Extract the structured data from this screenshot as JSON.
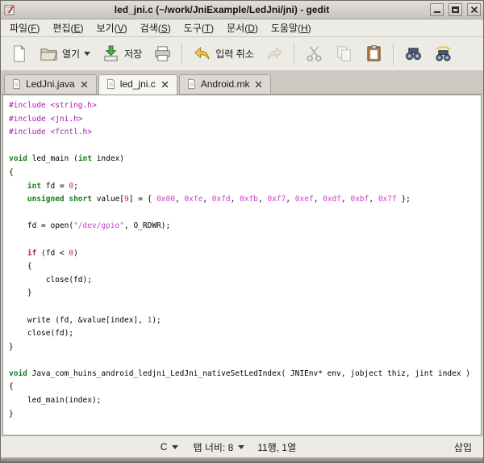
{
  "window": {
    "title": "led_jni.c (~/work/JniExample/LedJni/jni) - gedit"
  },
  "menu": {
    "items": [
      "파일(F)",
      "편집(E)",
      "보기(V)",
      "검색(S)",
      "도구(T)",
      "문서(D)",
      "도움말(H)"
    ]
  },
  "toolbar": {
    "open_label": "열기",
    "save_label": "저장",
    "undo_label": "입력 취소"
  },
  "tabs": [
    {
      "label": "LedJni.java",
      "active": false
    },
    {
      "label": "led_jni.c",
      "active": true
    },
    {
      "label": "Android.mk",
      "active": false
    }
  ],
  "statusbar": {
    "language": "C",
    "tab_width": "탭 너비: 8",
    "cursor_position": "11행, 1열",
    "mode": "삽입"
  },
  "icons": {
    "titlebar": [
      "gedit-logo-icon",
      "minimize-icon",
      "maximize-icon",
      "close-icon"
    ],
    "toolbar": [
      "new-document-icon",
      "open-folder-icon",
      "save-icon",
      "print-icon",
      "undo-icon",
      "redo-icon",
      "cut-icon",
      "copy-icon",
      "paste-icon",
      "find-icon",
      "find-replace-icon"
    ],
    "tabs": [
      "document-icon",
      "close-icon"
    ],
    "statusbar": [
      "chevron-down-icon"
    ]
  },
  "colors": {
    "chrome_bg": "#edebe6",
    "titlebar_bg": "#d4d1ca",
    "code_bg": "#ffffff",
    "preprocessor": "#b116b1",
    "type_keyword": "#18801c",
    "control_keyword": "#b22222",
    "number": "#d42a2a",
    "hex_number": "#cf3ecb",
    "string": "#cf3ecb",
    "undo_arrow": "#f6c445",
    "save_arrow": "#4caf50"
  },
  "code": {
    "lines": [
      [
        {
          "t": "#include <string.h>",
          "c": "pre"
        }
      ],
      [
        {
          "t": "#include <jni.h>",
          "c": "pre"
        }
      ],
      [
        {
          "t": "#include <fcntl.h>",
          "c": "pre"
        }
      ],
      [],
      [
        {
          "t": "void",
          "c": "kw"
        },
        {
          "t": " led_main (",
          "c": "pl"
        },
        {
          "t": "int",
          "c": "kw"
        },
        {
          "t": " index)",
          "c": "pl"
        }
      ],
      [
        {
          "t": "{",
          "c": "pl"
        }
      ],
      [
        {
          "t": "    ",
          "c": "pl"
        },
        {
          "t": "int",
          "c": "kw"
        },
        {
          "t": " fd = ",
          "c": "pl"
        },
        {
          "t": "0",
          "c": "num"
        },
        {
          "t": ";",
          "c": "pl"
        }
      ],
      [
        {
          "t": "    ",
          "c": "pl"
        },
        {
          "t": "unsigned short",
          "c": "kw"
        },
        {
          "t": " value[",
          "c": "pl"
        },
        {
          "t": "9",
          "c": "num"
        },
        {
          "t": "] = { ",
          "c": "pl"
        },
        {
          "t": "0x00",
          "c": "hex"
        },
        {
          "t": ", ",
          "c": "pl"
        },
        {
          "t": "0xfe",
          "c": "hex"
        },
        {
          "t": ", ",
          "c": "pl"
        },
        {
          "t": "0xfd",
          "c": "hex"
        },
        {
          "t": ", ",
          "c": "pl"
        },
        {
          "t": "0xfb",
          "c": "hex"
        },
        {
          "t": ", ",
          "c": "pl"
        },
        {
          "t": "0xf7",
          "c": "hex"
        },
        {
          "t": ", ",
          "c": "pl"
        },
        {
          "t": "0xef",
          "c": "hex"
        },
        {
          "t": ", ",
          "c": "pl"
        },
        {
          "t": "0xdf",
          "c": "hex"
        },
        {
          "t": ", ",
          "c": "pl"
        },
        {
          "t": "0xbf",
          "c": "hex"
        },
        {
          "t": ", ",
          "c": "pl"
        },
        {
          "t": "0x7f",
          "c": "hex"
        },
        {
          "t": " };",
          "c": "pl"
        }
      ],
      [],
      [
        {
          "t": "    fd = open(",
          "c": "pl"
        },
        {
          "t": "\"/dev/gpio\"",
          "c": "str"
        },
        {
          "t": ", O_RDWR);",
          "c": "pl"
        }
      ],
      [],
      [
        {
          "t": "    ",
          "c": "pl"
        },
        {
          "t": "if",
          "c": "ctrl"
        },
        {
          "t": " (fd < ",
          "c": "pl"
        },
        {
          "t": "0",
          "c": "num"
        },
        {
          "t": ")",
          "c": "pl"
        }
      ],
      [
        {
          "t": "    {",
          "c": "pl"
        }
      ],
      [
        {
          "t": "        close(fd);",
          "c": "pl"
        }
      ],
      [
        {
          "t": "    }",
          "c": "pl"
        }
      ],
      [],
      [
        {
          "t": "    write (fd, &value[index], ",
          "c": "pl"
        },
        {
          "t": "1",
          "c": "num"
        },
        {
          "t": ");",
          "c": "pl"
        }
      ],
      [
        {
          "t": "    close(fd);",
          "c": "pl"
        }
      ],
      [
        {
          "t": "}",
          "c": "pl"
        }
      ],
      [],
      [
        {
          "t": "void",
          "c": "kw"
        },
        {
          "t": " Java_com_huins_android_ledjni_LedJni_nativeSetLedIndex( JNIEnv* env, jobject thiz, jint index )",
          "c": "pl"
        }
      ],
      [
        {
          "t": "{",
          "c": "pl"
        }
      ],
      [
        {
          "t": "    led_main(index);",
          "c": "pl"
        }
      ],
      [
        {
          "t": "}",
          "c": "pl"
        }
      ]
    ]
  }
}
